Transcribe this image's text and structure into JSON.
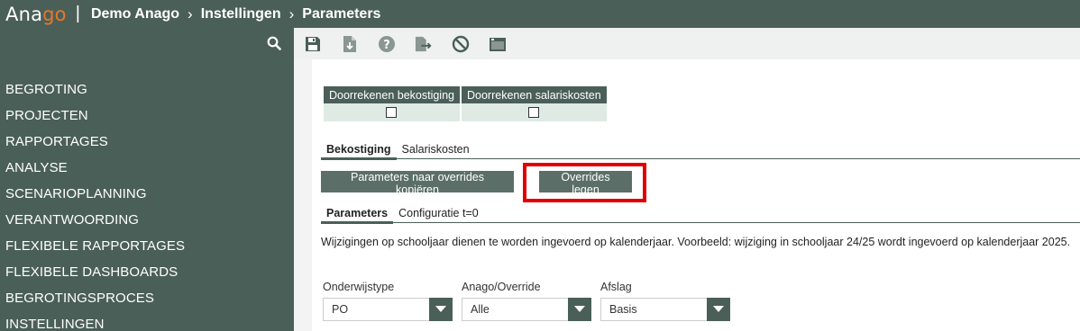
{
  "header": {
    "logo": {
      "part1": "Ana",
      "part2": "go"
    },
    "separator": "|",
    "breadcrumbs": [
      "Demo Anago",
      "Instellingen",
      "Parameters"
    ],
    "breadcrumb_separator": "›"
  },
  "sidebar": {
    "search_icon": "search-icon",
    "items": [
      {
        "label": "BEGROTING"
      },
      {
        "label": "PROJECTEN"
      },
      {
        "label": "RAPPORTAGES"
      },
      {
        "label": "ANALYSE"
      },
      {
        "label": "SCENARIOPLANNING"
      },
      {
        "label": "VERANTWOORDING"
      },
      {
        "label": "FLEXIBELE RAPPORTAGES"
      },
      {
        "label": "FLEXIBELE DASHBOARDS"
      },
      {
        "label": "BEGROTINGSPROCES"
      },
      {
        "label": "INSTELLINGEN"
      }
    ]
  },
  "toolbar": {
    "icons": [
      "save-icon",
      "download-icon",
      "help-icon",
      "export-icon",
      "cancel-icon",
      "window-icon"
    ]
  },
  "calc_table": {
    "headers": [
      "Doorrekenen bekostiging",
      "Doorrekenen salariskosten"
    ],
    "checked": [
      false,
      false
    ]
  },
  "tabs_main": {
    "items": [
      {
        "label": "Bekostiging",
        "active": true
      },
      {
        "label": "Salariskosten",
        "active": false
      }
    ]
  },
  "buttons": {
    "copy_label": "Parameters naar overrides kopiëren",
    "clear_label": "Overrides legen"
  },
  "tabs_sub": {
    "items": [
      {
        "label": "Parameters",
        "active": true
      },
      {
        "label": "Configuratie t=0",
        "active": false
      }
    ]
  },
  "info_text": "Wijzigingen op schooljaar dienen te worden ingevoerd op kalenderjaar. Voorbeeld: wijziging in schooljaar 24/25 wordt ingevoerd op kalenderjaar 2025.",
  "filters": [
    {
      "label": "Onderwijstype",
      "value": "PO"
    },
    {
      "label": "Anago/Override",
      "value": "Alle"
    },
    {
      "label": "Afslag",
      "value": "Basis"
    }
  ],
  "colors": {
    "brand_dark": "#4b5f59",
    "logo_accent": "#e8782a",
    "highlight": "#e00000"
  }
}
